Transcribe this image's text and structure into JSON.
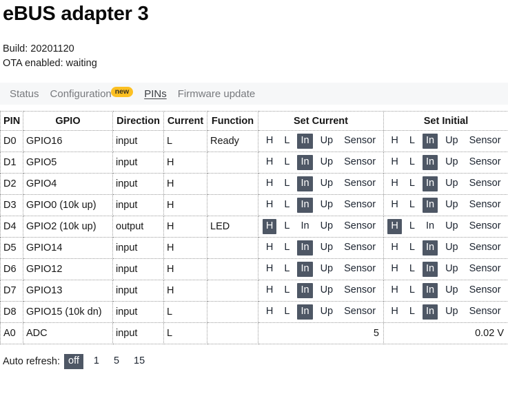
{
  "header": {
    "title": "eBUS adapter 3",
    "build_label": "Build: 20201120",
    "ota_label": "OTA enabled: waiting"
  },
  "tabs": [
    {
      "label": "Status",
      "active": false,
      "badge": null
    },
    {
      "label": "Configuration",
      "active": false,
      "badge": "new"
    },
    {
      "label": "PINs",
      "active": true,
      "badge": null
    },
    {
      "label": "Firmware update",
      "active": false,
      "badge": null
    }
  ],
  "table": {
    "headers": {
      "pin": "PIN",
      "gpio": "GPIO",
      "direction": "Direction",
      "current": "Current",
      "function": "Function",
      "set_current": "Set Current",
      "set_initial": "Set Initial"
    },
    "options": [
      "H",
      "L",
      "In",
      "Up",
      "Sensor"
    ],
    "rows": [
      {
        "pin": "D0",
        "gpio": "GPIO16",
        "direction": "input",
        "current": "L",
        "function": "Ready",
        "set_current": "In",
        "set_initial": "In"
      },
      {
        "pin": "D1",
        "gpio": "GPIO5",
        "direction": "input",
        "current": "H",
        "function": "",
        "set_current": "In",
        "set_initial": "In"
      },
      {
        "pin": "D2",
        "gpio": "GPIO4",
        "direction": "input",
        "current": "H",
        "function": "",
        "set_current": "In",
        "set_initial": "In"
      },
      {
        "pin": "D3",
        "gpio": "GPIO0 (10k up)",
        "direction": "input",
        "current": "H",
        "function": "",
        "set_current": "In",
        "set_initial": "In"
      },
      {
        "pin": "D4",
        "gpio": "GPIO2 (10k up)",
        "direction": "output",
        "current": "H",
        "function": "LED",
        "set_current": "H",
        "set_initial": "H"
      },
      {
        "pin": "D5",
        "gpio": "GPIO14",
        "direction": "input",
        "current": "H",
        "function": "",
        "set_current": "In",
        "set_initial": "In"
      },
      {
        "pin": "D6",
        "gpio": "GPIO12",
        "direction": "input",
        "current": "H",
        "function": "",
        "set_current": "In",
        "set_initial": "In"
      },
      {
        "pin": "D7",
        "gpio": "GPIO13",
        "direction": "input",
        "current": "H",
        "function": "",
        "set_current": "In",
        "set_initial": "In"
      },
      {
        "pin": "D8",
        "gpio": "GPIO15 (10k dn)",
        "direction": "input",
        "current": "L",
        "function": "",
        "set_current": "In",
        "set_initial": "In"
      }
    ],
    "analog_row": {
      "pin": "A0",
      "gpio": "ADC",
      "direction": "input",
      "current": "L",
      "function": "",
      "raw_value": "5",
      "voltage": "0.02 V"
    }
  },
  "footer": {
    "label": "Auto refresh:",
    "options": [
      "off",
      "1",
      "5",
      "15"
    ],
    "selected": "off"
  },
  "colors": {
    "selected_bg": "#4e5765",
    "badge_bg": "#fcc023",
    "tabbar_bg": "#f6f7f8",
    "text": "#161616",
    "tab_text": "#77797d"
  }
}
